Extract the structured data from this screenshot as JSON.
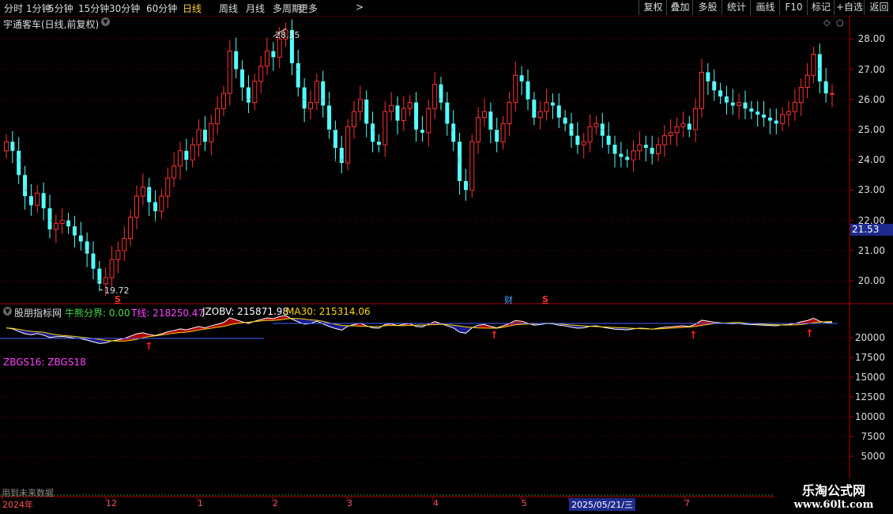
{
  "toolbar": {
    "periods": [
      "分时",
      "1分钟",
      "5分钟",
      "15分钟",
      "30分钟",
      "60分钟",
      "日线",
      "周线",
      "月线",
      "多周期",
      "更多"
    ],
    "active_period": "日线",
    "more_arrow": ">",
    "buttons": [
      "复权",
      "叠加",
      "多股",
      "统计",
      "画线",
      "F10",
      "标记",
      "+自选",
      "返回"
    ]
  },
  "main_chart": {
    "title": "宇通客车(日线,前复权)",
    "collapse_icon": "chevron-down-icon",
    "high_label": "28.35",
    "low_label": "19.72",
    "current_price_label": "21.53",
    "y_ticks": [
      "28.00",
      "27.00",
      "26.00",
      "25.00",
      "24.00",
      "23.00",
      "22.00",
      "21.00",
      "20.00"
    ],
    "events": [
      {
        "text": "S",
        "color": "#ff3030",
        "kind": "sell-mark-1"
      },
      {
        "text": "财",
        "color": "#4aa0ff",
        "kind": "finance-mark"
      },
      {
        "text": "S",
        "color": "#ff3030",
        "kind": "sell-mark-2"
      }
    ]
  },
  "indicator": {
    "name": "股朋指标网",
    "items": [
      {
        "label": "牛熊分界: 0.00",
        "color": "#44dd44"
      },
      {
        "label": "T线: 218250.47",
        "color": "#ff44ff"
      },
      {
        "label": "JZOBV: 215871.98",
        "color": "#ffffff"
      },
      {
        "label": "MA30: 215314.06",
        "color": "#ffd700"
      }
    ],
    "sub_label": "ZBGS16:  ZBGS18",
    "y_ticks": [
      "20000",
      "17500",
      "15000",
      "12500",
      "10000",
      "7500",
      "5000"
    ]
  },
  "footer": {
    "status_text": "用到未来数据",
    "dates": [
      "2024年",
      "12",
      "1",
      "2",
      "3",
      "4",
      "5",
      "2025/05/21/三",
      "7"
    ],
    "watermark_title": "乐淘公式网",
    "watermark_url": "www.60lt.com"
  },
  "colors": {
    "up": "#ff3232",
    "down": "#54ffff",
    "axis_line": "#b00000",
    "accent_highlight": "#1e2b8c"
  },
  "chart_data": {
    "type": "candlestick",
    "title": "宇通客车(日线,前复权)",
    "ylim": [
      19.6,
      28.7
    ],
    "marked_high": 28.35,
    "marked_low": 19.72,
    "last_price": 21.53,
    "close_series": [
      24.6,
      24.3,
      23.5,
      22.8,
      22.5,
      22.9,
      22.4,
      21.7,
      21.9,
      22.0,
      21.8,
      21.5,
      21.3,
      20.9,
      20.4,
      19.9,
      20.1,
      20.7,
      21.0,
      21.4,
      22.1,
      22.8,
      23.1,
      22.6,
      22.3,
      22.8,
      23.4,
      23.8,
      24.3,
      24.0,
      24.5,
      25.0,
      24.6,
      25.2,
      25.7,
      26.2,
      27.6,
      27.0,
      26.4,
      25.9,
      26.6,
      27.1,
      27.6,
      27.4,
      28.0,
      28.3,
      27.2,
      26.4,
      25.7,
      25.9,
      26.6,
      25.8,
      25.0,
      24.4,
      23.9,
      25.1,
      25.6,
      26.0,
      25.2,
      24.6,
      24.5,
      25.6,
      25.8,
      25.3,
      25.7,
      25.9,
      25.0,
      24.9,
      25.7,
      26.5,
      25.9,
      25.2,
      24.6,
      23.3,
      23.0,
      24.6,
      25.4,
      25.6,
      25.0,
      24.6,
      25.2,
      25.9,
      26.8,
      26.6,
      26.0,
      25.4,
      25.6,
      25.9,
      25.8,
      25.4,
      25.2,
      24.8,
      24.5,
      24.6,
      25.1,
      25.2,
      24.8,
      24.5,
      24.2,
      24.1,
      24.0,
      24.3,
      24.5,
      24.4,
      24.2,
      24.5,
      24.8,
      24.9,
      25.1,
      25.2,
      25.0,
      25.7,
      26.9,
      26.6,
      26.3,
      26.1,
      25.9,
      25.8,
      25.9,
      25.7,
      25.6,
      25.5,
      25.4,
      25.3,
      25.2,
      25.5,
      25.6,
      25.9,
      26.4,
      26.8,
      27.5,
      26.6,
      26.2,
      26.2
    ]
  }
}
